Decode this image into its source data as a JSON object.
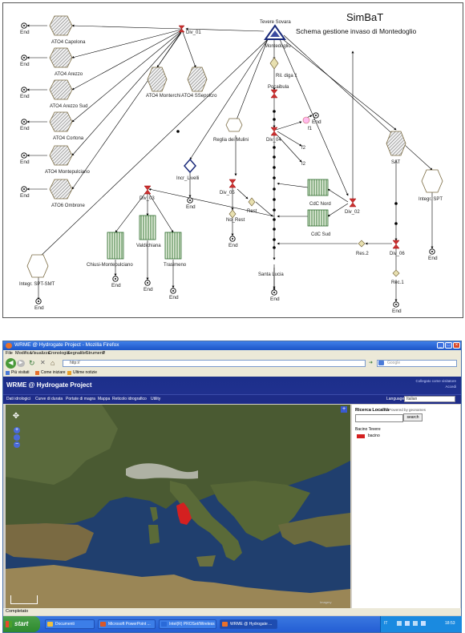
{
  "diagram": {
    "title": "SimBaT",
    "subtitle": "Schema gestione invaso di Montedoglio",
    "end_label": "End",
    "nodes": {
      "tevere_sovara": "Tevere Sovara",
      "montedoglio": "Montedoglio",
      "div_01": "Div_01",
      "ato4_capolona": "ATO4 Capolona",
      "ato4_arezzo": "ATO4 Arezzo",
      "ato4_arezzo_sud": "ATO4 Arezzo Sud",
      "ato4_cortona": "ATO4 Cortona",
      "ato4_montepulciano": "ATO4 Montepulciano",
      "ato6_ombrone": "ATO6 Ombrone",
      "ato4_monterchi": "ATO4 Monterchi",
      "ato4_ssepolcro": "ATO4 SSepolcro",
      "ril_diga1": "Ril. diga 1",
      "pocaibula": "Pocaibula",
      "f1": "f1",
      "div_04": "Div_04",
      "f2": "f2",
      "i2": "I2",
      "reglia_mulini": "Reglia dei Mulini",
      "incr_livelli": "Incr_Livelli",
      "div_05": "Div_05",
      "no_rest": "No_Rest",
      "rest": "Rest",
      "div_03": "Div_03",
      "valdichiana": "Valdichiana",
      "chiusi_montepulciano": "Chiusi-Montepulciano",
      "trasimeno": "Trasimeno",
      "cdc_nord": "CdC Nord",
      "cdc_sud": "CdC Sud",
      "div_02": "Div_02",
      "sat": "SAT",
      "integr_spt": "Integr. SPT",
      "integr_spt_smt": "Integr. SPT-SMT",
      "santa_lucia": "Santa Lucia",
      "res2": "Res.2",
      "div_06": "Div_06",
      "rec1": "Rec.1"
    }
  },
  "browser": {
    "window_title": "WRME @ Hydrogate Project - Mozilla Firefox",
    "menu": [
      "File",
      "Modifica",
      "Visualizza",
      "Cronologia",
      "Segnalibri",
      "Strumenti",
      "?"
    ],
    "url": "http://",
    "search_placeholder": "Google",
    "bookmarks": [
      "Più visitati",
      "Come iniziare",
      "Ultime notizie"
    ],
    "app_title": "WRME @ Hydrogate Project",
    "login_status": "Collegato come visitatore",
    "login_link": "Accedi",
    "app_nav": [
      "Dati idrologici",
      "Curve di durata",
      "Portate di magra",
      "Mappa",
      "Reticolo idrografico",
      "Utility"
    ],
    "language_label": "Language",
    "language_value": "Italian",
    "search_panel": {
      "title": "Ricerca Località",
      "powered": "Powered by geonames",
      "button": "search",
      "legend_title": "Bacino Tevere",
      "legend_item": "bacino",
      "legend_color": "#d42020"
    },
    "map_attribution": "Imagery",
    "status": "Completato",
    "taskbar": {
      "start": "start",
      "items": [
        "Documenti",
        "Microsoft PowerPoint ...",
        "Intel(R) PROSet/Wireless",
        "WRME @ Hydrogate ..."
      ],
      "lang": "IT",
      "clock": "18:53"
    }
  }
}
